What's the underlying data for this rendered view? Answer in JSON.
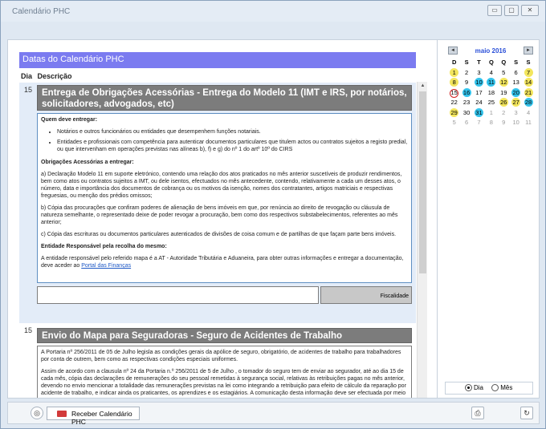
{
  "window": {
    "title": "Calendário PHC",
    "min": "▭",
    "max": "▢",
    "close": "✕"
  },
  "main": {
    "header": "Datas do Calendário PHC",
    "col_day": "Dia",
    "col_desc": "Descrição",
    "entries": [
      {
        "day": "15",
        "title": "Entrega de Obrigações Acessórias - Entrega do Modelo 11 (IMT e IRS, por notários, solicitadores, advogados, etc)",
        "who_heading": "Quem deve entregar:",
        "bullets": [
          "Notários e outros funcionários ou entidades que desempenhem funções notariais.",
          "Entidades e profissionais com competência para autenticar documentos particulares que titulem actos ou contratos sujeitos a registo predial, ou que intervenham em operações previstas nas alíneas b), f) e g) do nº 1 do artº 10º do CIRS"
        ],
        "obligations_heading": "Obrigações Acessórias a entregar:",
        "para_a": "a) Declaração Modelo 11 em suporte eletrónico, contendo uma relação dos atos praticados no mês anterior suscetíveis de produzir rendimentos, bem como atos ou contratos sujeitos a IMT, ou dele isentos, efectuados no mês antecedente, contendo, relativamente a cada um desses atos, o número, data e importância dos documentos de cobrança ou os motivos da isenção, nomes dos contratantes, artigos matriciais e respectivas freguesias, ou menção dos prédios omissos;",
        "para_b": "b) Cópia das procurações que confiram poderes de alienação de bens imóveis em que, por renúncia ao direito de revogação ou cláusula de natureza semelhante, o representado deixe de poder revogar a procuração, bem como dos respectivos substabelecimentos, referentes ao mês anterior;",
        "para_c": "c) Cópia das escrituras ou documentos particulares autenticados de divisões de coisa comum e de partilhas de que façam parte bens imóveis.",
        "entity_heading": "Entidade Responsável pela recolha do mesmo:",
        "entity_text": "A entidade responsável pelo referido mapa é a AT - Autoridade Tributária e Aduaneira, para obter outras informações e entregar a documentação, deve aceder ao",
        "link": "Portal das Finanças",
        "category": "Fiscalidade"
      },
      {
        "day": "15",
        "title": "Envio do Mapa para Seguradoras - Seguro de Acidentes de Trabalho",
        "para1": "A Portaria nº 256/2011 de 05 de Julho legisla as condições gerais da apólice de seguro, obrigatório, de acidentes de trabalho para trabalhadores por conta de outrem, bem como as respectivas condições especiais uniformes.",
        "para2": "Assim de acordo com a clausula nº 24 da Portaria n.º 256/2011 de 5 de Julho , o tomador do seguro tem de enviar ao segurador, até ao dia 15 de cada mês, cópia das declarações de remunerações do seu pessoal remetidas à segurança social, relativas às retribuições pagas no mês anterior, devendo no envio mencionar a totalidade das remunerações previstas na lei como integrando a retribuição para efeito de cálculo da reparação por acidente de trabalho, e indicar ainda os praticantes, os aprendizes e os estagiários. A comunicação desta informação deve ser efectuada por meio informático,"
      }
    ]
  },
  "calendar": {
    "month_label": "maio 2016",
    "prev": "◄",
    "next": "►",
    "weekdays": [
      "D",
      "S",
      "T",
      "Q",
      "Q",
      "S",
      "S"
    ],
    "weeks": [
      [
        "1",
        "2",
        "3",
        "4",
        "5",
        "6",
        "7"
      ],
      [
        "8",
        "9",
        "10",
        "11",
        "12",
        "13",
        "14"
      ],
      [
        "15",
        "16",
        "17",
        "18",
        "19",
        "20",
        "21"
      ],
      [
        "22",
        "23",
        "24",
        "25",
        "26",
        "27",
        "28"
      ],
      [
        "29",
        "30",
        "31",
        "1",
        "2",
        "3",
        "4"
      ],
      [
        "5",
        "6",
        "7",
        "8",
        "9",
        "10",
        "11"
      ]
    ],
    "highlight_yellow": [
      "1",
      "7",
      "8",
      "12",
      "14",
      "21",
      "26",
      "27",
      "29"
    ],
    "highlight_blue": [
      "10",
      "11",
      "16",
      "20",
      "28",
      "31"
    ],
    "today": "15",
    "colors": {
      "yellow": "#f3e65e",
      "blue": "#33c3ec",
      "today_ring": "#d12020",
      "other_month": "#9a9a9a"
    },
    "view_day": "Dia",
    "view_month": "Mês",
    "selected_view": "Dia"
  },
  "footer": {
    "receive_label": "Receber Calendário PHC"
  },
  "colors": {
    "header_bar": "#7b7bf0",
    "card_title": "#7c7c7c",
    "selected_row": "#e3ecf8"
  }
}
